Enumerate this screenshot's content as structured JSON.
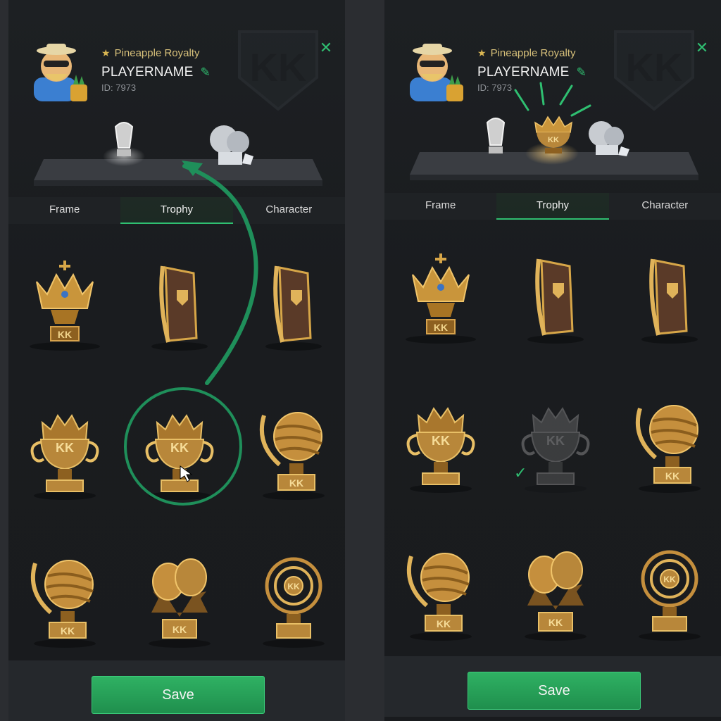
{
  "panels": [
    {
      "id": "left",
      "rank_title": "Pineapple Royalty",
      "player_name": "PLAYERNAME",
      "player_id": "ID: 7973",
      "tabs": [
        {
          "label": "Frame",
          "active": false
        },
        {
          "label": "Trophy",
          "active": true
        },
        {
          "label": "Character",
          "active": false
        }
      ],
      "save_label": "Save",
      "selected_cell": 4,
      "annotation": "circle-and-arrow"
    },
    {
      "id": "right",
      "rank_title": "Pineapple Royalty",
      "player_name": "PLAYERNAME",
      "player_id": "ID: 7973",
      "tabs": [
        {
          "label": "Frame",
          "active": false
        },
        {
          "label": "Trophy",
          "active": true
        },
        {
          "label": "Character",
          "active": false
        }
      ],
      "save_label": "Save",
      "equipped_cell": 4,
      "check_icon": "checkmark-icon"
    }
  ],
  "trophies": [
    {
      "icon": "crown-trophy-icon"
    },
    {
      "icon": "banner-shield-trophy-icon"
    },
    {
      "icon": "banner-shield-trophy-icon"
    },
    {
      "icon": "kk-cup-trophy-icon"
    },
    {
      "icon": "kk-cup-trophy-icon"
    },
    {
      "icon": "sphere-trophy-icon"
    },
    {
      "icon": "sphere-trophy-icon"
    },
    {
      "icon": "boxing-gloves-trophy-icon"
    },
    {
      "icon": "rings-trophy-icon"
    }
  ],
  "colors": {
    "accent_green": "#2fbf71",
    "gold": "#c9953b",
    "rank_gold": "#d7c07a"
  }
}
